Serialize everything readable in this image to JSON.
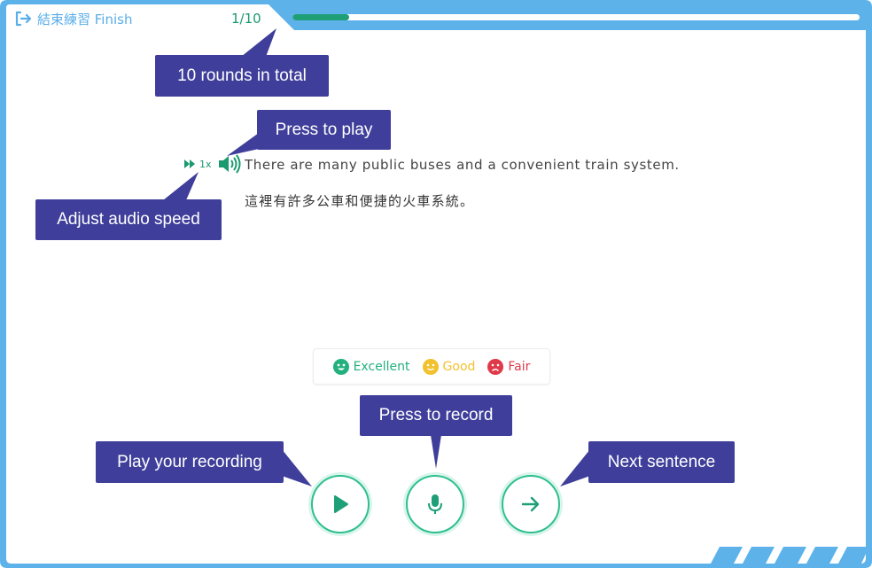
{
  "header": {
    "finish_label": "結束練習 Finish",
    "round_text": "1/10",
    "progress_fraction": 0.1
  },
  "sentence": {
    "english": "There are many public buses and a convenient train system.",
    "chinese": "這裡有許多公車和便捷的火車系統。",
    "speed_label": "1x"
  },
  "rating_legend": {
    "items": [
      {
        "label": "Excellent",
        "color": "#22b07d",
        "icon": "smile-face-icon"
      },
      {
        "label": "Good",
        "color": "#f2c12e",
        "icon": "neutral-face-icon"
      },
      {
        "label": "Fair",
        "color": "#e0394a",
        "icon": "frown-face-icon"
      }
    ]
  },
  "tooltips": {
    "rounds": "10 rounds in total",
    "play": "Press to play",
    "speed": "Adjust audio speed",
    "record": "Press to record",
    "playback": "Play your recording",
    "next": "Next sentence"
  },
  "colors": {
    "frame": "#5db2ea",
    "accent": "#1e9f78",
    "tooltip_bg": "#3f3f9b"
  }
}
